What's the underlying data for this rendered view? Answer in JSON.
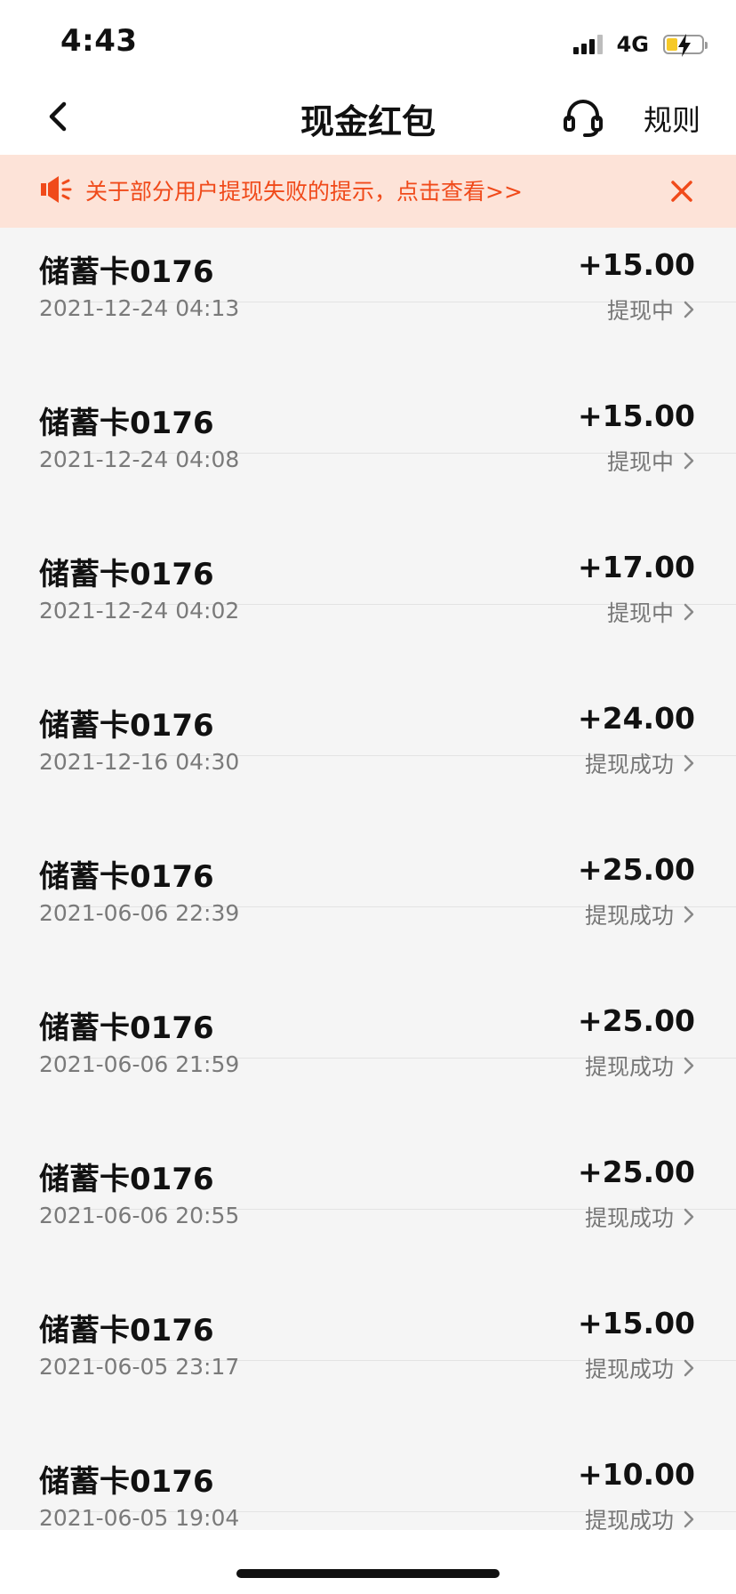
{
  "status_bar": {
    "time": "4:43",
    "network": "4G",
    "signal_icon": "signal-bars-icon",
    "battery_icon": "battery-charging-icon",
    "battery_color": "#f6c928"
  },
  "nav": {
    "title": "现金红包",
    "back_icon": "chevron-left-icon",
    "service_icon": "headset-icon",
    "rules_label": "规则"
  },
  "notice": {
    "icon": "megaphone-icon",
    "text": "关于部分用户提现失败的提示，点击查看>>",
    "close_icon": "close-icon",
    "accent_color": "#f04a1a",
    "background_color": "#fde3d8"
  },
  "records": [
    {
      "title": "储蓄卡0176",
      "date": "2021-12-24 04:13",
      "amount": "+15.00",
      "status": "提现中"
    },
    {
      "title": "储蓄卡0176",
      "date": "2021-12-24 04:08",
      "amount": "+15.00",
      "status": "提现中"
    },
    {
      "title": "储蓄卡0176",
      "date": "2021-12-24 04:02",
      "amount": "+17.00",
      "status": "提现中"
    },
    {
      "title": "储蓄卡0176",
      "date": "2021-12-16 04:30",
      "amount": "+24.00",
      "status": "提现成功"
    },
    {
      "title": "储蓄卡0176",
      "date": "2021-06-06 22:39",
      "amount": "+25.00",
      "status": "提现成功"
    },
    {
      "title": "储蓄卡0176",
      "date": "2021-06-06 21:59",
      "amount": "+25.00",
      "status": "提现成功"
    },
    {
      "title": "储蓄卡0176",
      "date": "2021-06-06 20:55",
      "amount": "+25.00",
      "status": "提现成功"
    },
    {
      "title": "储蓄卡0176",
      "date": "2021-06-05 23:17",
      "amount": "+15.00",
      "status": "提现成功"
    },
    {
      "title": "储蓄卡0176",
      "date": "2021-06-05 19:04",
      "amount": "+10.00",
      "status": "提现成功"
    }
  ],
  "row_chevron_icon": "chevron-right-icon"
}
